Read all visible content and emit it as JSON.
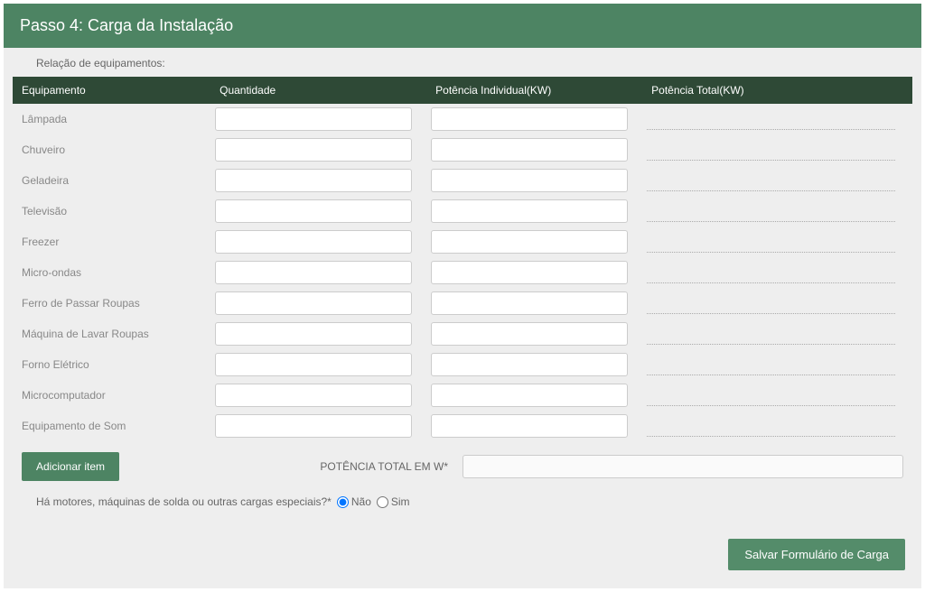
{
  "header": {
    "title": "Passo 4: Carga da Instalação"
  },
  "section": {
    "label": "Relação de equipamentos:"
  },
  "table": {
    "columns": {
      "equipment": "Equipamento",
      "quantity": "Quantidade",
      "individual_power": "Potência Individual(KW)",
      "total_power": "Potência Total(KW)"
    },
    "rows": [
      {
        "name": "Lâmpada"
      },
      {
        "name": "Chuveiro"
      },
      {
        "name": "Geladeira"
      },
      {
        "name": "Televisão"
      },
      {
        "name": "Freezer"
      },
      {
        "name": "Micro-ondas"
      },
      {
        "name": "Ferro de Passar Roupas"
      },
      {
        "name": "Máquina de Lavar Roupas"
      },
      {
        "name": "Forno Elétrico"
      },
      {
        "name": "Microcomputador"
      },
      {
        "name": "Equipamento de Som"
      }
    ]
  },
  "actions": {
    "add_item": "Adicionar item",
    "total_label": "POTÊNCIA TOTAL EM W*"
  },
  "special_loads": {
    "question": "Há motores, máquinas de solda ou outras cargas especiais?*",
    "option_no": "Não",
    "option_yes": "Sim",
    "selected": "no"
  },
  "footer": {
    "save_button": "Salvar Formulário de Carga"
  }
}
